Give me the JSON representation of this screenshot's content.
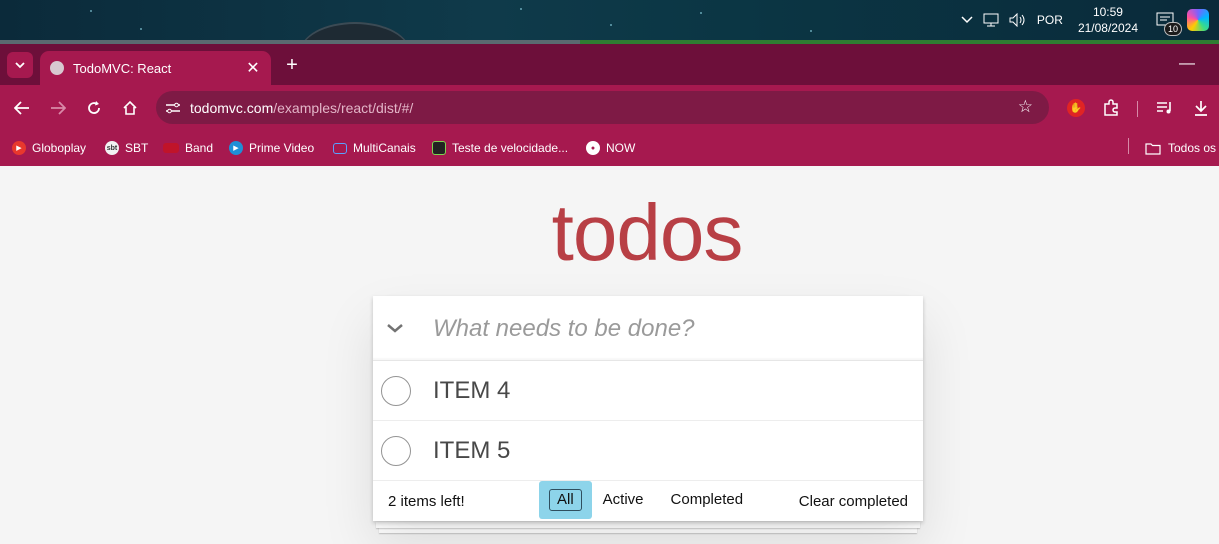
{
  "taskbar": {
    "language": "POR",
    "time": "10:59",
    "date": "21/08/2024",
    "notification_count": "10"
  },
  "browser": {
    "tab_title": "TodoMVC: React",
    "url_host": "todomvc.com",
    "url_path": "/examples/react/dist/#/",
    "bookmarks": [
      {
        "label": "Globoplay",
        "color": "#e8382d",
        "icon": "globoplay-icon"
      },
      {
        "label": "SBT",
        "color": "#f2f2f2",
        "icon": "sbt-icon"
      },
      {
        "label": "Band",
        "color": "#c0142a",
        "icon": "band-icon"
      },
      {
        "label": "Prime Video",
        "color": "#1f8fd6",
        "icon": "prime-video-icon"
      },
      {
        "label": "MultiCanais",
        "color": "#5aa0ff",
        "icon": "multicanais-icon"
      },
      {
        "label": "Teste de velocidade...",
        "color": "#222222",
        "icon": "speedtest-icon"
      },
      {
        "label": "NOW",
        "color": "#ffffff",
        "icon": "globe-icon"
      }
    ],
    "all_bookmarks_label": "Todos os"
  },
  "app": {
    "heading": "todos",
    "new_todo_placeholder": "What needs to be done?",
    "todos": [
      {
        "label": "ITEM 4",
        "completed": false
      },
      {
        "label": "ITEM 5",
        "completed": false
      }
    ],
    "items_left": "2 items left!",
    "filters": {
      "all": "All",
      "active": "Active",
      "completed": "Completed",
      "selected": "All"
    },
    "clear_completed": "Clear completed"
  },
  "colors": {
    "heading": "#b83f45",
    "browser_accent": "#a6194f",
    "tabstrip": "#6d0f3a",
    "selected_filter_bg": "#8dd4ea"
  }
}
